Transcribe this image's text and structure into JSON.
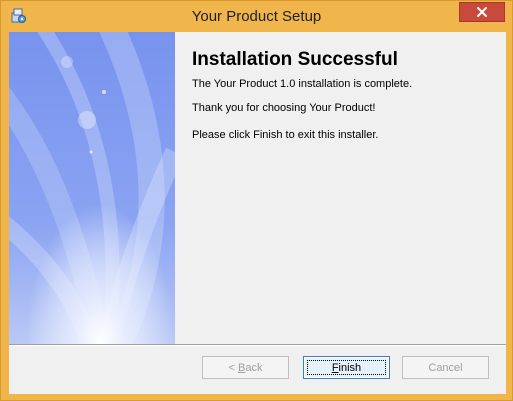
{
  "window": {
    "title": "Your Product Setup",
    "accent_color": "#f0b64b",
    "close_color": "#c74a3d",
    "icons": {
      "app": "setup-package-icon",
      "close": "close-icon"
    }
  },
  "content": {
    "heading": "Installation Successful",
    "line1": "The Your Product 1.0 installation is complete.",
    "line2": "Thank you for choosing Your Product!",
    "line3": "Please click Finish to exit this installer."
  },
  "buttons": {
    "back": {
      "mnemonic": "B",
      "rest": "ack",
      "prefix": "< ",
      "enabled": false
    },
    "finish": {
      "mnemonic": "F",
      "rest": "inish",
      "enabled": true,
      "default": true
    },
    "cancel": {
      "label": "Cancel",
      "enabled": false
    }
  }
}
